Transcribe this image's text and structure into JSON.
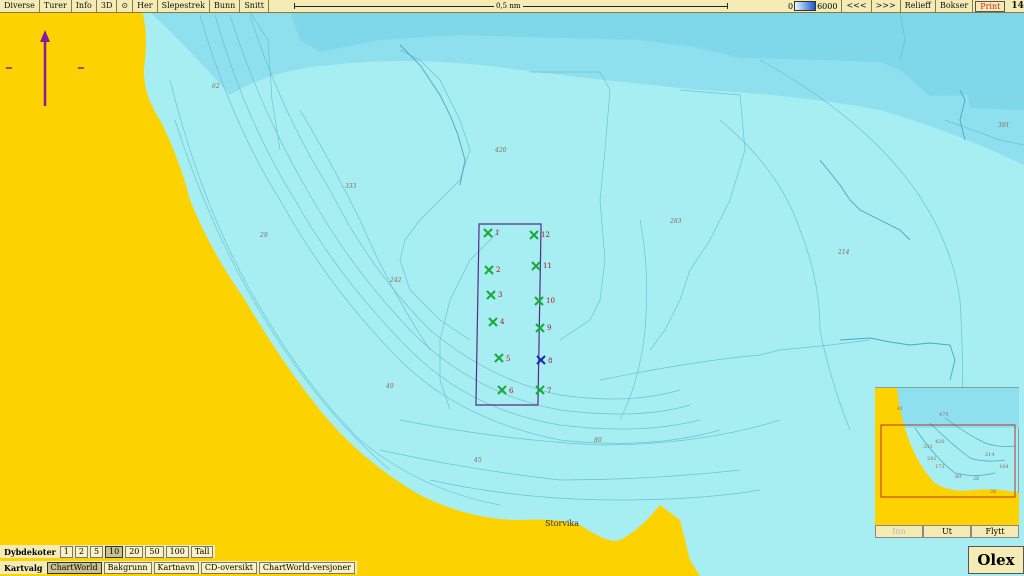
{
  "toolbar": {
    "items": [
      "Diverse",
      "Turer",
      "Info",
      "3D",
      "Her",
      "Slepestrek",
      "Bunn",
      "Snitt"
    ],
    "scale_label": "0,5 nm",
    "legend_min": "0",
    "legend_max": "6000",
    "prev": "<<<",
    "next": ">>>",
    "relief": "Relieff",
    "bokser": "Bokser",
    "print": "Print",
    "clock": "14:44:54"
  },
  "map": {
    "place_name": "Storvika",
    "waypoints": [
      "1",
      "2",
      "3",
      "4",
      "5",
      "6",
      "7",
      "8",
      "9",
      "10",
      "11",
      "12"
    ],
    "depth_labels": [
      "62",
      "420",
      "333",
      "283",
      "29",
      "242",
      "214",
      "49",
      "80",
      "45",
      "391",
      "475",
      "164",
      "26"
    ],
    "colors": {
      "land": "#fcd200",
      "shallow": "#a6eef2",
      "deep": "#8ee0ee",
      "marker": "#1aa83a",
      "selected_marker": "#1a2aa8",
      "box": "#5a2a8a"
    }
  },
  "depth_bar": {
    "label": "Dybdekoter",
    "options": [
      "1",
      "2",
      "5",
      "10",
      "20",
      "50",
      "100",
      "Tall"
    ],
    "selected": "10"
  },
  "chart_bar": {
    "label": "Kartvalg",
    "options": [
      "ChartWorld",
      "Bakgrunn",
      "Kartnavn",
      "CD-oversikt",
      "ChartWorld-versjoner"
    ],
    "selected": "ChartWorld"
  },
  "minimap": {
    "buttons": [
      "Inn",
      "Ut",
      "Flytt"
    ],
    "labels": [
      "41",
      "475",
      "420",
      "333",
      "242",
      "173",
      "214",
      "80",
      "26",
      "26",
      "164"
    ]
  },
  "brand": "Olex"
}
